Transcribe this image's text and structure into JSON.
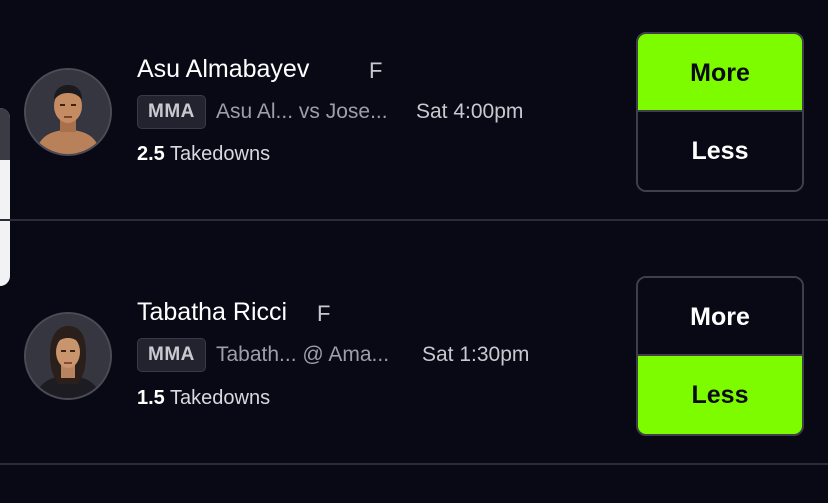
{
  "accent_color": "#7dfc00",
  "projections": [
    {
      "player_name": "Asu Almabayev",
      "position": "F",
      "league": "MMA",
      "matchup": "Asu Al... vs Jose...",
      "time": "Sat 4:00pm",
      "line": "2.5",
      "stat": "Takedowns",
      "more_label": "More",
      "less_label": "Less",
      "selected": "More"
    },
    {
      "player_name": "Tabatha Ricci",
      "position": "F",
      "league": "MMA",
      "matchup": "Tabath... @ Ama...",
      "time": "Sat 1:30pm",
      "line": "1.5",
      "stat": "Takedowns",
      "more_label": "More",
      "less_label": "Less",
      "selected": "Less"
    }
  ]
}
